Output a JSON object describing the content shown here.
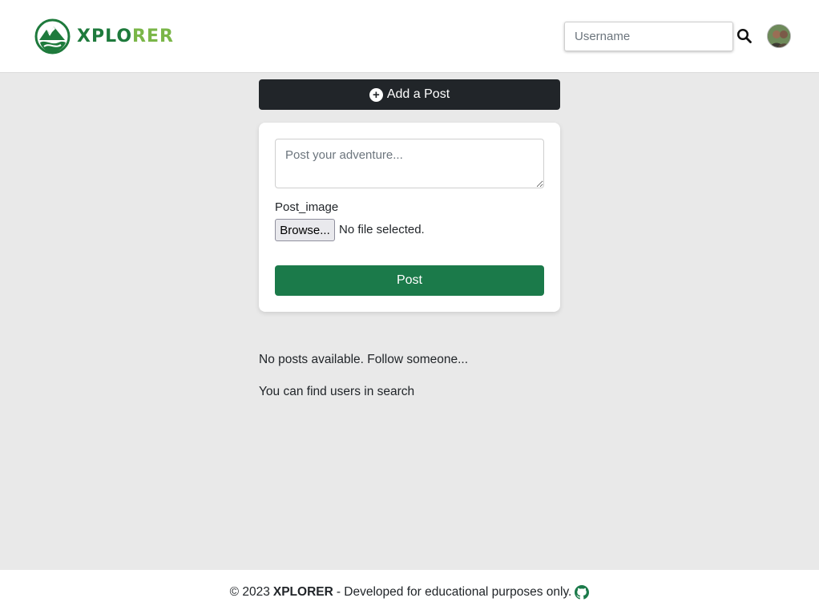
{
  "header": {
    "logo_text_part1": "XPLO",
    "logo_text_part2": "RER",
    "search": {
      "placeholder": "Username"
    },
    "icons": {
      "logo": "mountain-logo-icon",
      "search": "search-icon",
      "avatar": "user-avatar"
    }
  },
  "composer": {
    "add_post_label": "Add a Post",
    "add_post_icon": "plus-circle-icon",
    "text_placeholder": "Post your adventure...",
    "image_label": "Post_image",
    "browse_label": "Browse...",
    "file_status": "No file selected.",
    "submit_label": "Post"
  },
  "feed": {
    "empty_message": "No posts available. Follow someone...",
    "hint_message": "You can find users in search"
  },
  "footer": {
    "copyright": "© 2023",
    "brand": "XPLORER",
    "tagline": "- Developed for educational purposes only.",
    "icon": "github-icon"
  },
  "colors": {
    "primary_green": "#1b7a4a",
    "logo_dark_green": "#1e7a3c",
    "logo_light_green": "#7ab648",
    "dark_button": "#212529",
    "page_background": "#e9e9e9"
  }
}
